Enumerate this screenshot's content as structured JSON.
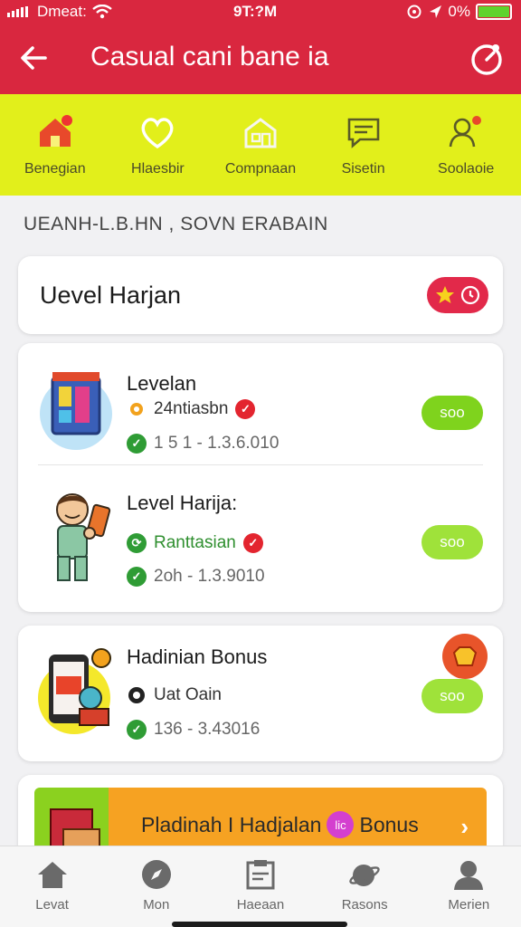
{
  "status_bar": {
    "carrier": "Dmeat:",
    "time": "9T:?M",
    "battery": "0%",
    "battery_level": 1.0
  },
  "header": {
    "title": "Casual cani bane ia"
  },
  "categories": [
    {
      "label": "Benegian",
      "icon": "house-icon"
    },
    {
      "label": "Hlaesbir",
      "icon": "heart-icon"
    },
    {
      "label": "Compnaan",
      "icon": "building-icon"
    },
    {
      "label": "Sisetin",
      "icon": "chat-icon"
    },
    {
      "label": "Soolaoie",
      "icon": "person-icon"
    }
  ],
  "section_title": "UEANH-L.B.HN ,  SOVN ERABAIN",
  "level_card": {
    "title": "Uevel Harjan"
  },
  "list_items": [
    {
      "title": "Levelan",
      "subtitle": "24ntiasbn",
      "date": "1 5 1 -   1.3.6.010",
      "pill": "soo"
    },
    {
      "title": "Level Harija:",
      "subtitle": "Ranttasian",
      "date": "2oh -   1.3.9010",
      "pill": "soo"
    }
  ],
  "bonus_item": {
    "title": "Hadinian Bonus",
    "subtitle": "Uat Oain",
    "date": "136 -   3.43016",
    "pill": "soo"
  },
  "promo": {
    "text": "Pladinah I Hadjalan",
    "badge": "lic",
    "suffix": "Bonus"
  },
  "bottom_nav": [
    {
      "label": "Levat",
      "icon": "home-icon"
    },
    {
      "label": "Mon",
      "icon": "compass-icon"
    },
    {
      "label": "Haeaan",
      "icon": "clipboard-icon"
    },
    {
      "label": "Rasons",
      "icon": "planet-icon"
    },
    {
      "label": "Merien",
      "icon": "user-icon"
    }
  ],
  "colors": {
    "brand_red": "#d9273f",
    "strip_yellow": "#e2ef1b",
    "pill_green": "#7fd31d",
    "promo_orange": "#f6a222"
  }
}
